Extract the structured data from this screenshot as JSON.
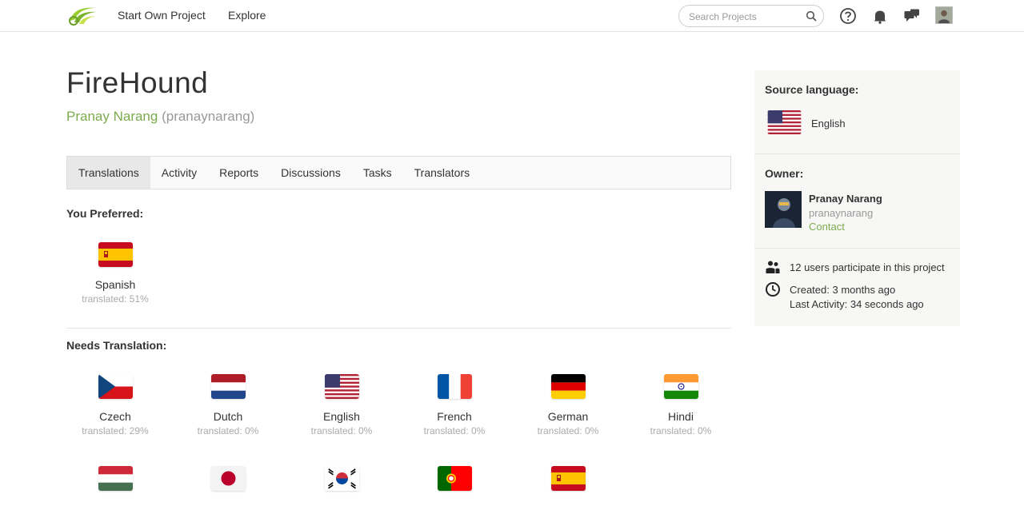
{
  "nav": {
    "start_project": "Start Own Project",
    "explore": "Explore",
    "search_placeholder": "Search Projects"
  },
  "project": {
    "title": "FireHound",
    "owner_name": "Pranay Narang",
    "owner_username": "(pranaynarang)"
  },
  "tabs": [
    {
      "label": "Translations",
      "active": true
    },
    {
      "label": "Activity"
    },
    {
      "label": "Reports"
    },
    {
      "label": "Discussions"
    },
    {
      "label": "Tasks"
    },
    {
      "label": "Translators"
    }
  ],
  "preferred": {
    "heading": "You Preferred:",
    "items": [
      {
        "name": "Spanish",
        "pct": "translated: 51%",
        "flag": "spain"
      }
    ]
  },
  "needs": {
    "heading": "Needs Translation:",
    "items": [
      {
        "name": "Czech",
        "pct": "translated: 29%",
        "flag": "czech"
      },
      {
        "name": "Dutch",
        "pct": "translated: 0%",
        "flag": "netherlands"
      },
      {
        "name": "English",
        "pct": "translated: 0%",
        "flag": "usa"
      },
      {
        "name": "French",
        "pct": "translated: 0%",
        "flag": "france"
      },
      {
        "name": "German",
        "pct": "translated: 0%",
        "flag": "germany"
      },
      {
        "name": "Hindi",
        "pct": "translated: 0%",
        "flag": "india"
      },
      {
        "name": "",
        "pct": "",
        "flag": "hungary"
      },
      {
        "name": "",
        "pct": "",
        "flag": "japan"
      },
      {
        "name": "",
        "pct": "",
        "flag": "korea"
      },
      {
        "name": "",
        "pct": "",
        "flag": "portugal"
      },
      {
        "name": "",
        "pct": "",
        "flag": "spain"
      }
    ]
  },
  "sidebar": {
    "source_label": "Source language:",
    "source_language": "English",
    "owner_label": "Owner:",
    "owner_name": "Pranay Narang",
    "owner_username": "pranaynarang",
    "contact": "Contact",
    "participants": "12 users participate in this project",
    "created": "Created: 3 months ago",
    "last_activity": "Last Activity: 34 seconds ago"
  },
  "colors": {
    "accent_green": "#7bab4e",
    "tab_active_bg": "#e8e8e8",
    "sidebar_bg": "#f7f7f5"
  },
  "icons": [
    "logo-icon",
    "search-icon",
    "help-icon",
    "bell-icon",
    "chat-icon",
    "users-icon",
    "clock-icon"
  ]
}
